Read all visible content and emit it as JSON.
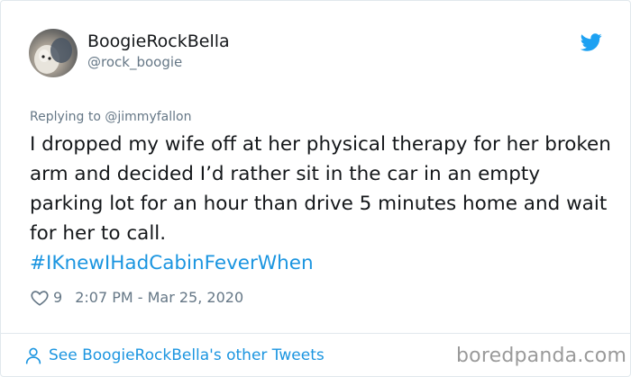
{
  "author": {
    "display_name": "BoogieRockBella",
    "handle": "@rock_boogie"
  },
  "reply": {
    "prefix": "Replying to ",
    "mention": "@jimmyfallon"
  },
  "tweet": {
    "text": "I dropped my wife off at her physical therapy for her broken arm and decided I’d rather sit in the car in an empty parking lot for an hour than drive 5 minutes home and wait for her to call.",
    "hashtag": "#IKnewIHadCabinFeverWhen"
  },
  "meta": {
    "likes": "9",
    "timestamp": "2:07 PM - Mar 25, 2020"
  },
  "footer": {
    "link_text": "See BoogieRockBella's other Tweets"
  },
  "watermark": "boredpanda.com",
  "icons": {
    "brand": "twitter-bird-icon",
    "like": "heart-outline-icon",
    "profile": "person-icon"
  },
  "colors": {
    "accent": "#1b95e0",
    "secondary_text": "#657786",
    "border": "#e1e8ed"
  }
}
